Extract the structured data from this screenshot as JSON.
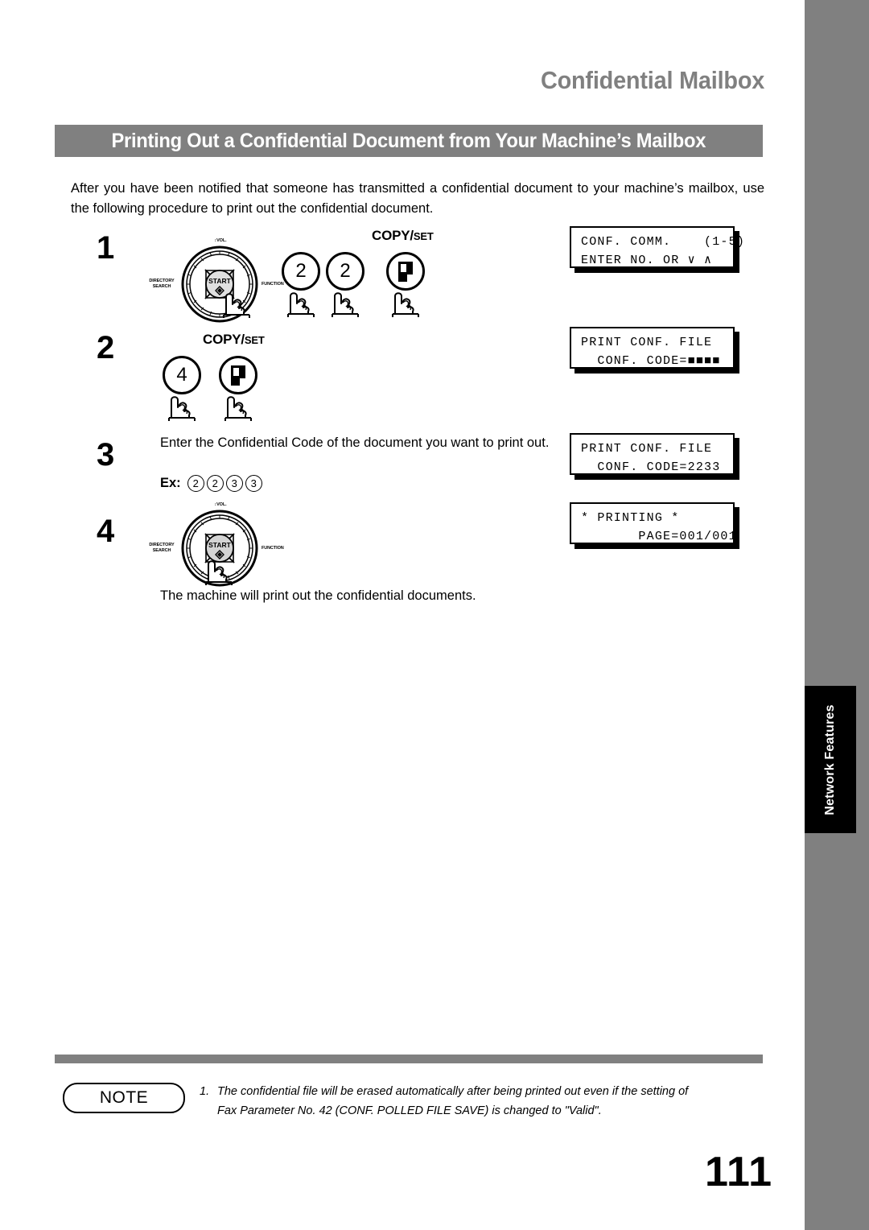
{
  "header": {
    "chapter_title": "Confidential Mailbox",
    "section_title": "Printing Out a Confidential Document from Your Machine’s Mailbox",
    "banner_color": "#808080"
  },
  "intro": "After you have been notified that someone has transmitted a confidential document to your machine’s mailbox, use the following procedure to print out the confidential document.",
  "steps": [
    {
      "number": "1",
      "copyset": {
        "copy": "COPY",
        "slash": "/",
        "set": "SET"
      },
      "keys": [
        "2",
        "2",
        "page-icon"
      ],
      "navpad": {
        "start_label": "START",
        "vol_label": "VOL.",
        "left_label_line1": "DIRECTORY",
        "left_label_line2": "SEARCH",
        "right_label": "FUNCTION",
        "pressed": "right-arrow"
      }
    },
    {
      "number": "2",
      "copyset": {
        "copy": "COPY",
        "slash": "/",
        "set": "SET"
      },
      "keys": [
        "4",
        "page-icon"
      ]
    },
    {
      "number": "3",
      "text_line1": "Enter the Confidential Code of the document you want to",
      "text_line2": "print out.",
      "ex_label": "Ex:",
      "ex_digits": [
        "2",
        "2",
        "3",
        "3"
      ]
    },
    {
      "number": "4",
      "navpad": {
        "start_label": "START",
        "vol_label": "VOL.",
        "left_label_line1": "DIRECTORY",
        "left_label_line2": "SEARCH",
        "right_label": "FUNCTION",
        "pressed": "start-button"
      },
      "caption": "The machine will print out the confidential documents."
    }
  ],
  "displays": [
    {
      "line1": "CONF. COMM.    (1-5)",
      "line2": "ENTER NO. OR ∨ ∧"
    },
    {
      "line1": "PRINT CONF. FILE",
      "line2": "  CONF. CODE=■■■■"
    },
    {
      "line1": "PRINT CONF. FILE",
      "line2": "  CONF. CODE=2233"
    },
    {
      "line1": "* PRINTING *",
      "line2": "       PAGE=001/001"
    }
  ],
  "side_tab": {
    "label": "Network Features"
  },
  "note": {
    "badge": "NOTE",
    "item_number": "1.",
    "line1": "The confidential file will be erased automatically after being printed out even if the setting of",
    "line2": "Fax Parameter No. 42 (CONF. POLLED FILE SAVE) is changed to \"Valid\"."
  },
  "page_number": "111"
}
